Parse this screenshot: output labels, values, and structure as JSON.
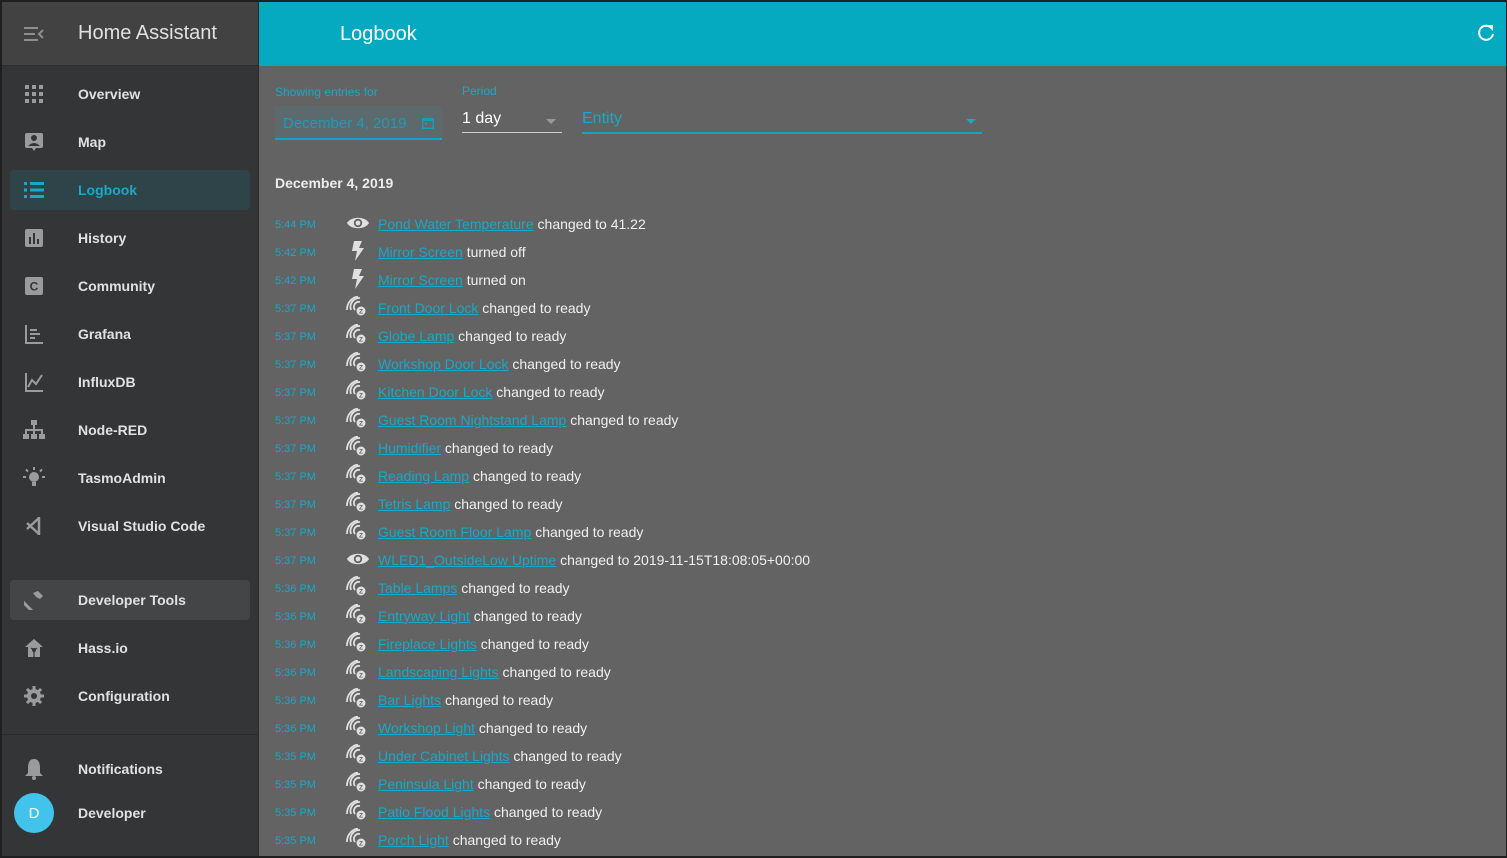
{
  "sidebar": {
    "title": "Home Assistant",
    "items": [
      {
        "label": "Overview",
        "icon": "grid-icon"
      },
      {
        "label": "Map",
        "icon": "map-icon"
      },
      {
        "label": "Logbook",
        "icon": "list-icon",
        "active": true
      },
      {
        "label": "History",
        "icon": "chart-bar-icon"
      },
      {
        "label": "Community",
        "icon": "community-icon"
      },
      {
        "label": "Grafana",
        "icon": "grafana-icon"
      },
      {
        "label": "InfluxDB",
        "icon": "influxdb-icon"
      },
      {
        "label": "Node-RED",
        "icon": "sitemap-icon"
      },
      {
        "label": "TasmoAdmin",
        "icon": "lightbulb-icon"
      },
      {
        "label": "Visual Studio Code",
        "icon": "vscode-icon"
      }
    ],
    "bottom_items": [
      {
        "label": "Developer Tools",
        "icon": "hammer-icon"
      },
      {
        "label": "Hass.io",
        "icon": "hassio-icon"
      },
      {
        "label": "Configuration",
        "icon": "gear-icon"
      }
    ],
    "notifications_label": "Notifications",
    "user_name": "Developer",
    "user_initial": "D"
  },
  "header": {
    "title": "Logbook"
  },
  "filters": {
    "date_label": "Showing entries for",
    "date_value": "December 4, 2019",
    "period_label": "Period",
    "period_value": "1 day",
    "entity_placeholder": "Entity"
  },
  "log": {
    "date_heading": "December 4, 2019",
    "entries": [
      {
        "time": "5:44 PM",
        "icon": "eye",
        "name": "Pond Water Temperature",
        "message": "changed to 41.22"
      },
      {
        "time": "5:42 PM",
        "icon": "flash",
        "name": "Mirror Screen",
        "message": "turned off"
      },
      {
        "time": "5:42 PM",
        "icon": "flash",
        "name": "Mirror Screen",
        "message": "turned on"
      },
      {
        "time": "5:37 PM",
        "icon": "zwave",
        "name": "Front Door Lock",
        "message": "changed to ready"
      },
      {
        "time": "5:37 PM",
        "icon": "zwave",
        "name": "Globe Lamp",
        "message": "changed to ready"
      },
      {
        "time": "5:37 PM",
        "icon": "zwave",
        "name": "Workshop Door Lock",
        "message": "changed to ready"
      },
      {
        "time": "5:37 PM",
        "icon": "zwave",
        "name": "Kitchen Door Lock",
        "message": "changed to ready"
      },
      {
        "time": "5:37 PM",
        "icon": "zwave",
        "name": "Guest Room Nightstand Lamp",
        "message": "changed to ready"
      },
      {
        "time": "5:37 PM",
        "icon": "zwave",
        "name": "Humidifier",
        "message": "changed to ready"
      },
      {
        "time": "5:37 PM",
        "icon": "zwave",
        "name": "Reading Lamp",
        "message": "changed to ready"
      },
      {
        "time": "5:37 PM",
        "icon": "zwave",
        "name": "Tetris Lamp",
        "message": "changed to ready"
      },
      {
        "time": "5:37 PM",
        "icon": "zwave",
        "name": "Guest Room Floor Lamp",
        "message": "changed to ready"
      },
      {
        "time": "5:37 PM",
        "icon": "eye",
        "name": "WLED1_OutsideLow Uptime",
        "message": "changed to 2019-11-15T18:08:05+00:00"
      },
      {
        "time": "5:36 PM",
        "icon": "zwave",
        "name": "Table Lamps",
        "message": "changed to ready"
      },
      {
        "time": "5:36 PM",
        "icon": "zwave",
        "name": "Entryway Light",
        "message": "changed to ready"
      },
      {
        "time": "5:36 PM",
        "icon": "zwave",
        "name": "Fireplace Lights",
        "message": "changed to ready"
      },
      {
        "time": "5:36 PM",
        "icon": "zwave",
        "name": "Landscaping Lights",
        "message": "changed to ready"
      },
      {
        "time": "5:36 PM",
        "icon": "zwave",
        "name": "Bar Lights",
        "message": "changed to ready"
      },
      {
        "time": "5:36 PM",
        "icon": "zwave",
        "name": "Workshop Light",
        "message": "changed to ready"
      },
      {
        "time": "5:35 PM",
        "icon": "zwave",
        "name": "Under Cabinet Lights",
        "message": "changed to ready"
      },
      {
        "time": "5:35 PM",
        "icon": "zwave",
        "name": "Peninsula Light",
        "message": "changed to ready"
      },
      {
        "time": "5:35 PM",
        "icon": "zwave",
        "name": "Patio Flood Lights",
        "message": "changed to ready"
      },
      {
        "time": "5:35 PM",
        "icon": "zwave",
        "name": "Porch Light",
        "message": "changed to ready"
      }
    ]
  },
  "colors": {
    "accent": "#18a8c8",
    "header": "#05a9c0",
    "sidebar": "#333536",
    "content": "#636363",
    "avatar": "#41c3ec"
  }
}
